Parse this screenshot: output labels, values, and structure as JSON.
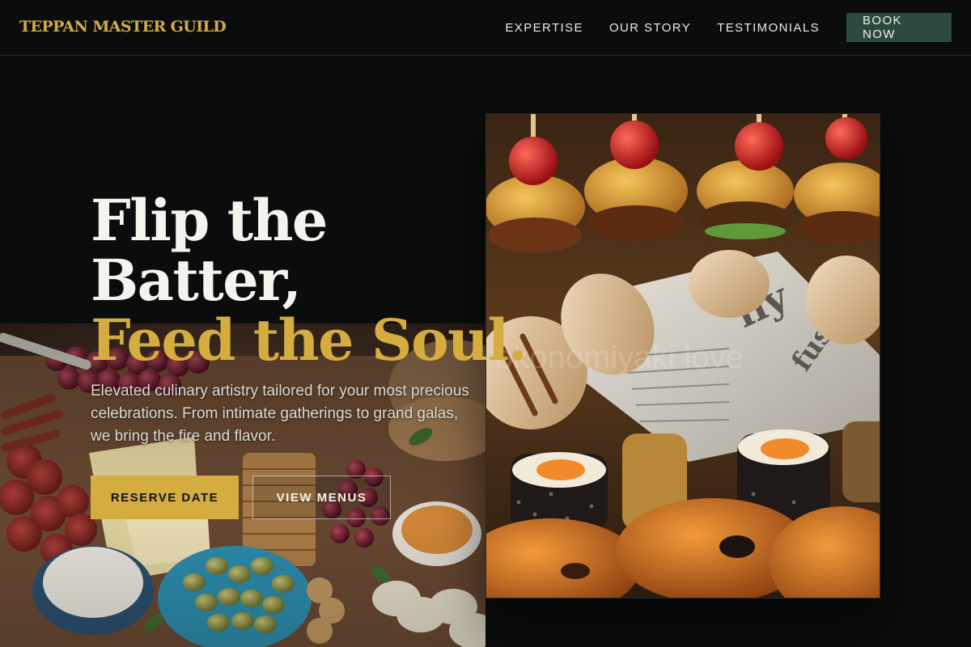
{
  "header": {
    "brand": "TEPPAN MASTER GUILD",
    "nav": [
      {
        "label": "EXPERTISE"
      },
      {
        "label": "OUR STORY"
      },
      {
        "label": "TESTIMONIALS"
      }
    ],
    "cta_label": "BOOK NOW"
  },
  "hero": {
    "title_line1": "Flip the",
    "title_line2": "Batter,",
    "title_accent": "Feed the Soul.",
    "subtitle": "Elevated culinary artistry tailored for your most precious celebrations. From intimate gatherings to grand galas, we bring the fire and flavor.",
    "primary_button": "RESERVE DATE",
    "secondary_button": "VIEW MENUS"
  },
  "images": {
    "left_photo": "charcuterie-board-photo",
    "right_photo": "appetizer-platter-photo",
    "watermark": "okonomiyaki love"
  },
  "colors": {
    "background": "#0a0d0c",
    "accent_gold": "#d4ac3f",
    "cta_green": "#2c4a3e",
    "text_light": "#f5f3ee"
  }
}
